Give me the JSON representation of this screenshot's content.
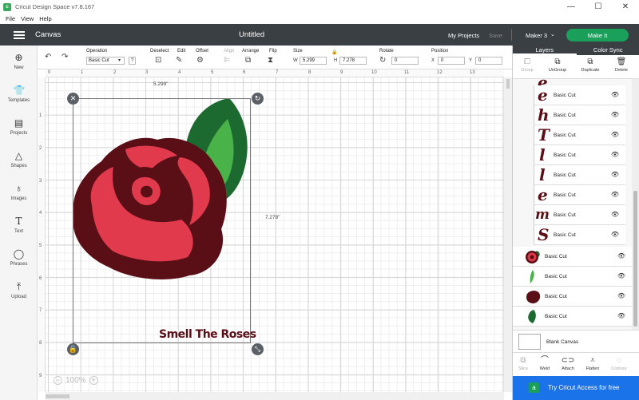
{
  "window": {
    "title": "Cricut Design Space  v7.8.167",
    "controls": [
      "—",
      "☐",
      "✕"
    ]
  },
  "menu": [
    "File",
    "View",
    "Help"
  ],
  "header": {
    "section": "Canvas",
    "doc_title": "Untitled",
    "my_projects": "My Projects",
    "save": "Save",
    "machine": "Maker 3",
    "make_it": "Make It"
  },
  "sidebar": [
    {
      "label": "New",
      "icon": "plus-circle-icon"
    },
    {
      "label": "Templates",
      "icon": "shirt-icon"
    },
    {
      "label": "Projects",
      "icon": "projects-icon"
    },
    {
      "label": "Shapes",
      "icon": "shapes-icon"
    },
    {
      "label": "Images",
      "icon": "lightbulb-icon"
    },
    {
      "label": "Text",
      "icon": "text-icon"
    },
    {
      "label": "Phrases",
      "icon": "speech-bubble-icon"
    },
    {
      "label": "Upload",
      "icon": "upload-icon"
    }
  ],
  "toolbar": {
    "operation_label": "Operation",
    "operation_value": "Basic Cut",
    "deselect": "Deselect",
    "edit": "Edit",
    "offset": "Offset",
    "align": "Align",
    "arrange": "Arrange",
    "flip": "Flip",
    "size": "Size",
    "w_label": "W",
    "w_value": "5.299",
    "h_label": "H",
    "h_value": "7.278",
    "rotate": "Rotate",
    "rotate_value": "0",
    "position": "Position",
    "x_label": "X",
    "x_value": "0",
    "y_label": "Y",
    "y_value": "0"
  },
  "rulers": {
    "top": [
      "0",
      "1",
      "2",
      "3",
      "4",
      "5",
      "6",
      "7",
      "8",
      "9",
      "10",
      "11",
      "12",
      "13"
    ],
    "left": [
      "1",
      "2",
      "3",
      "4",
      "5",
      "6",
      "7",
      "8",
      "9"
    ]
  },
  "canvas": {
    "width_dim": "5.299\"",
    "height_dim": "7.278\"",
    "text_object": "Smell The Roses",
    "zoom": "100%",
    "colors": {
      "rose_dark": "#5a0e16",
      "rose_red": "#e23a4d",
      "leaf_dark": "#1d6a30",
      "leaf_light": "#49b249"
    }
  },
  "right_panel": {
    "tabs": [
      "Layers",
      "Color Sync"
    ],
    "actions": [
      {
        "label": "Group",
        "icon": "group-icon",
        "enabled": false
      },
      {
        "label": "UnGroup",
        "icon": "ungroup-icon",
        "enabled": true
      },
      {
        "label": "Duplicate",
        "icon": "duplicate-icon",
        "enabled": true
      },
      {
        "label": "Delete",
        "icon": "trash-icon",
        "enabled": true
      }
    ],
    "layers": [
      {
        "glyph": "e",
        "name": "Basic Cut"
      },
      {
        "glyph": "h",
        "name": "Basic Cut"
      },
      {
        "glyph": "T",
        "name": "Basic Cut"
      },
      {
        "glyph": "l",
        "name": "Basic Cut"
      },
      {
        "glyph": "l",
        "name": "Basic Cut"
      },
      {
        "glyph": "e",
        "name": "Basic Cut"
      },
      {
        "glyph": "m",
        "name": "Basic Cut"
      },
      {
        "glyph": "S",
        "name": "Basic Cut"
      },
      {
        "thumb": "rose",
        "name": "Basic Cut"
      },
      {
        "thumb": "leaf-light",
        "name": "Basic Cut"
      },
      {
        "thumb": "rose-dark",
        "name": "Basic Cut"
      },
      {
        "thumb": "leaf-dark",
        "name": "Basic Cut"
      }
    ],
    "blank_canvas": "Blank Canvas",
    "bottom_actions": [
      {
        "label": "Slice",
        "icon": "slice-icon",
        "enabled": false
      },
      {
        "label": "Weld",
        "icon": "weld-icon",
        "enabled": true
      },
      {
        "label": "Attach",
        "icon": "attach-icon",
        "enabled": true
      },
      {
        "label": "Flatten",
        "icon": "flatten-icon",
        "enabled": true
      },
      {
        "label": "Contour",
        "icon": "contour-icon",
        "enabled": false
      }
    ],
    "promo": "Try Cricut Access for free"
  }
}
